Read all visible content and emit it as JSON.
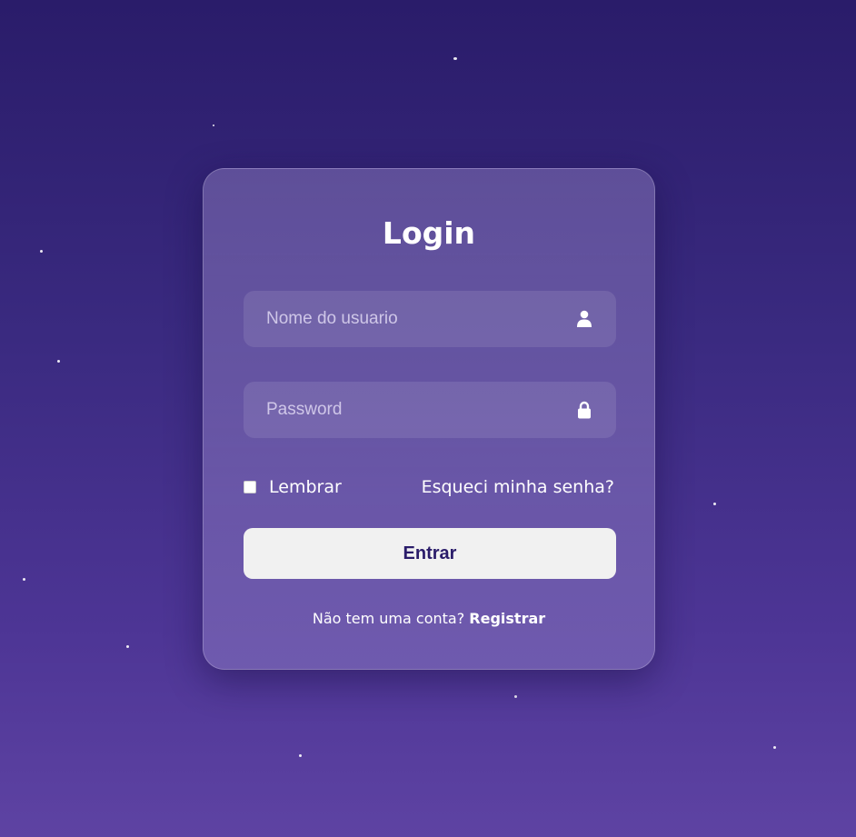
{
  "login_form": {
    "title": "Login",
    "username": {
      "placeholder": "Nome do usuario",
      "value": "",
      "icon": "user-icon"
    },
    "password": {
      "placeholder": "Password",
      "value": "",
      "icon": "lock-icon"
    },
    "remember_label": "Lembrar",
    "remember_checked": false,
    "forgot_label": "Esqueci minha senha?",
    "submit_label": "Entrar",
    "register_prompt": "Não tem uma conta?",
    "register_link": "Registrar"
  },
  "colors": {
    "background_top": "#2a1c6a",
    "background_bottom": "#5e43a3",
    "button_background": "#f1f1f1",
    "button_text": "#2a1c6a",
    "text": "#ffffff"
  }
}
